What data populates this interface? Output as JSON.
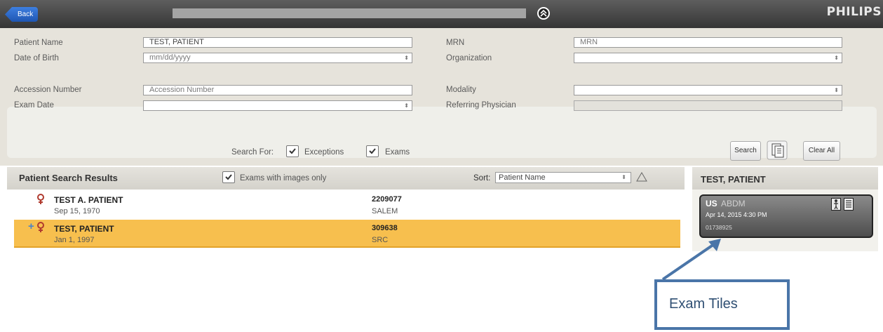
{
  "topbar": {
    "back_label": "Back",
    "brand": "PHILIPS"
  },
  "search_form": {
    "patient_name": {
      "label": "Patient Name",
      "value": "TEST, PATIENT"
    },
    "date_of_birth": {
      "label": "Date of Birth",
      "placeholder": "mm/dd/yyyy"
    },
    "mrn": {
      "label": "MRN",
      "placeholder": "MRN"
    },
    "organization": {
      "label": "Organization",
      "value": ""
    },
    "accession_number": {
      "label": "Accession Number",
      "placeholder": "Accession Number"
    },
    "exam_date": {
      "label": "Exam Date",
      "value": ""
    },
    "modality": {
      "label": "Modality",
      "value": ""
    },
    "referring_physician": {
      "label": "Referring Physician",
      "value": ""
    },
    "search_for_label": "Search For:",
    "exceptions": {
      "label": "Exceptions",
      "checked": true
    },
    "exams": {
      "label": "Exams",
      "checked": true
    },
    "search_button": "Search",
    "clear_all_button": "Clear All"
  },
  "results": {
    "title": "Patient Search Results",
    "images_only": {
      "label": "Exams with images only",
      "checked": true
    },
    "sort_label": "Sort:",
    "sort_value": "Patient Name",
    "rows": [
      {
        "name": "TEST A. PATIENT",
        "dob": "Sep 15, 1970",
        "mrn": "2209077",
        "org": "SALEM",
        "selected": false,
        "expandable": false
      },
      {
        "name": "TEST, PATIENT",
        "dob": "Jan 1, 1997",
        "mrn": "309638",
        "org": "SRC",
        "selected": true,
        "expandable": true
      }
    ]
  },
  "side": {
    "title": "TEST, PATIENT",
    "tile": {
      "modality": "US",
      "body_part": "ABDM",
      "date": "Apr 14, 2015 4:30 PM",
      "accession": "01738925"
    }
  },
  "callout": {
    "text": "Exam Tiles"
  },
  "colors": {
    "accent_blue": "#2a63c2",
    "selected_row": "#f7bf4e",
    "callout_border": "#4a75a8"
  }
}
